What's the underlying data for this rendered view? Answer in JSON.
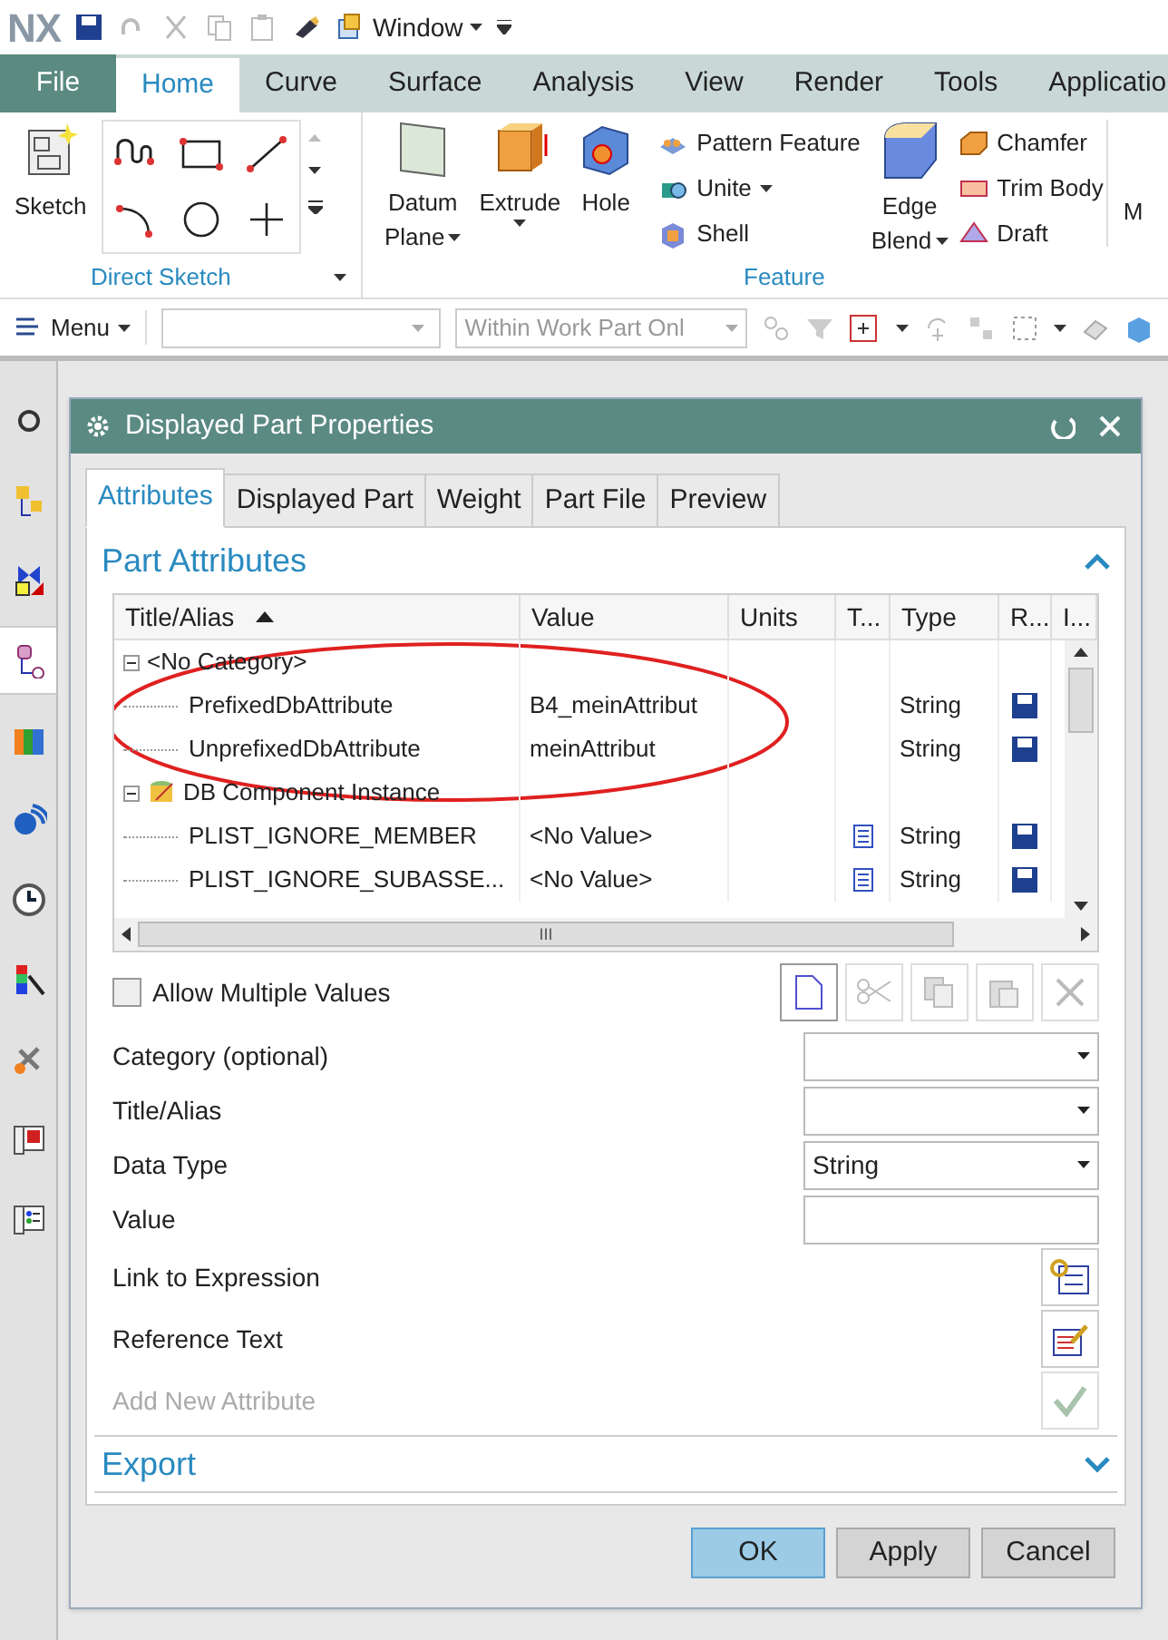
{
  "quick_access": {
    "logo": "NX",
    "window_menu": "Window"
  },
  "ribbon_tabs": [
    {
      "label": "File",
      "kind": "file",
      "selected": false
    },
    {
      "label": "Home",
      "kind": "tab",
      "selected": true
    },
    {
      "label": "Curve",
      "kind": "tab",
      "selected": false
    },
    {
      "label": "Surface",
      "kind": "tab",
      "selected": false
    },
    {
      "label": "Analysis",
      "kind": "tab",
      "selected": false
    },
    {
      "label": "View",
      "kind": "tab",
      "selected": false
    },
    {
      "label": "Render",
      "kind": "tab",
      "selected": false
    },
    {
      "label": "Tools",
      "kind": "tab",
      "selected": false
    },
    {
      "label": "Applicatio",
      "kind": "tab",
      "selected": false
    }
  ],
  "direct_sketch": {
    "sketch": "Sketch",
    "label": "Direct Sketch"
  },
  "feature": {
    "label": "Feature",
    "datum": [
      "Datum",
      "Plane"
    ],
    "extrude": "Extrude",
    "hole": "Hole",
    "pattern": "Pattern Feature",
    "unite": "Unite",
    "shell": "Shell",
    "edge_blend": [
      "Edge",
      "Blend"
    ],
    "chamfer": "Chamfer",
    "trim_body": "Trim Body",
    "draft": "Draft",
    "cut_off": "M"
  },
  "toolbar": {
    "menu": "Menu",
    "scope_filter": "Within Work Part Onl"
  },
  "resource_bar": [
    {
      "selected": false
    },
    {
      "selected": false
    },
    {
      "selected": false
    },
    {
      "selected": true
    },
    {
      "selected": false
    },
    {
      "selected": false
    },
    {
      "selected": false
    },
    {
      "selected": false
    },
    {
      "selected": false
    },
    {
      "selected": false
    },
    {
      "selected": false
    }
  ],
  "dialog": {
    "title": "Displayed Part Properties",
    "tabs": [
      {
        "label": "Attributes",
        "selected": true
      },
      {
        "label": "Displayed Part",
        "selected": false
      },
      {
        "label": "Weight",
        "selected": false
      },
      {
        "label": "Part File",
        "selected": false
      },
      {
        "label": "Preview",
        "selected": false
      }
    ],
    "section": {
      "label": "Part Attributes",
      "expanded": true
    },
    "table": {
      "columns": [
        {
          "label": "Title/Alias",
          "sorted": true
        },
        {
          "label": "Value"
        },
        {
          "label": "Units"
        },
        {
          "label": "T..."
        },
        {
          "label": "Type"
        },
        {
          "label": "R..."
        },
        {
          "label": "I..."
        }
      ],
      "groups": [
        {
          "title": "<No Category>",
          "expanded": true,
          "icon": false,
          "children": [
            {
              "title": "PrefixedDbAttribute",
              "value": "B4_meinAttribut",
              "text_icon": false,
              "type": "String"
            },
            {
              "title": "UnprefixedDbAttribute",
              "value": "meinAttribut",
              "text_icon": false,
              "type": "String"
            }
          ]
        },
        {
          "title": "DB Component Instance",
          "expanded": true,
          "icon": true,
          "children": [
            {
              "title": "PLIST_IGNORE_MEMBER",
              "value": "<No Value>",
              "text_icon": true,
              "type": "String"
            },
            {
              "title": "PLIST_IGNORE_SUBASSE...",
              "value": "<No Value>",
              "text_icon": true,
              "type": "String"
            }
          ]
        }
      ],
      "scroll_label": "III"
    },
    "allow_multiple": {
      "label": "Allow Multiple Values",
      "checked": false
    },
    "fields": [
      {
        "label": "Category (optional)",
        "kind": "dropdown"
      },
      {
        "label": "Title/Alias",
        "kind": "dropdown"
      },
      {
        "label": "Data Type",
        "kind": "dropdown",
        "value": "String"
      },
      {
        "label": "Value",
        "kind": "text"
      },
      {
        "label": "Link to Expression",
        "kind": "expression"
      },
      {
        "label": "Reference Text",
        "kind": "reference"
      },
      {
        "label": "Add New Attribute",
        "kind": "add",
        "disabled": true
      }
    ],
    "export": {
      "label": "Export",
      "expanded": false
    },
    "buttons": [
      {
        "label": "OK",
        "default": true
      },
      {
        "label": "Apply",
        "default": false
      },
      {
        "label": "Cancel",
        "default": false
      }
    ]
  }
}
